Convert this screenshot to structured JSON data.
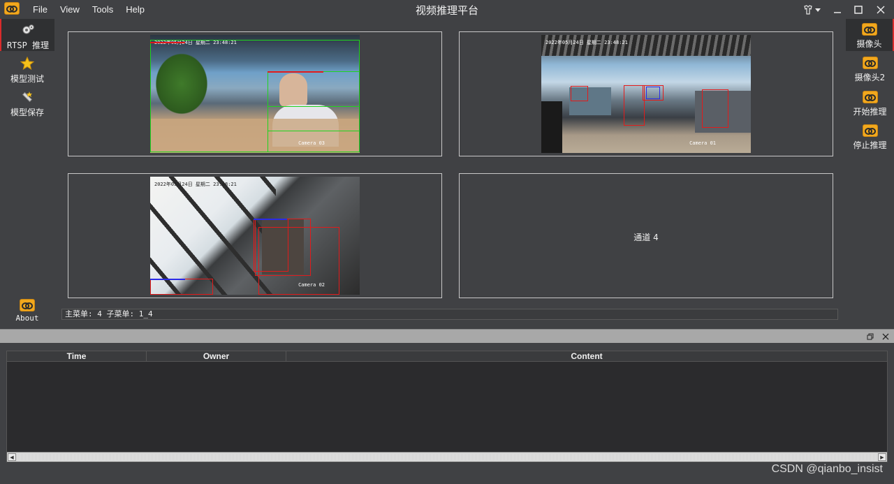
{
  "app": {
    "title": "视频推理平台",
    "menu": [
      "File",
      "View",
      "Tools",
      "Help"
    ]
  },
  "left_nav": {
    "items": [
      {
        "label": "RTSP 推理",
        "icon": "gear-icon",
        "active": true
      },
      {
        "label": "模型测试",
        "icon": "star-icon",
        "active": false
      },
      {
        "label": "模型保存",
        "icon": "wand-icon",
        "active": false
      }
    ],
    "about": {
      "label": "About",
      "icon": "logo-icon"
    }
  },
  "right_nav": {
    "items": [
      {
        "label": "摄像头",
        "active": true
      },
      {
        "label": "摄像头2",
        "active": false
      },
      {
        "label": "开始推理",
        "active": false
      },
      {
        "label": "停止推理",
        "active": false
      }
    ]
  },
  "channels": [
    {
      "stamp": "2022年05月24日 星期二 23:48:21",
      "camera": "Camera 03"
    },
    {
      "stamp": "2022年05月24日 星期二 23:48:21",
      "camera": "Camera 01"
    },
    {
      "stamp": "2022年05月24日 星期二 23:48:21",
      "camera": "Camera 02"
    },
    {
      "label": "通道 4"
    }
  ],
  "status": {
    "text": "主菜单: 4  子菜单: 1_4"
  },
  "log": {
    "columns": [
      "Time",
      "Owner",
      "Content"
    ],
    "rows": []
  },
  "watermark": "CSDN @qianbo_insist",
  "colors": {
    "background": "#404144",
    "accent": "#d92b2b",
    "logo": "#f2a81d",
    "box_green": "#1fd41f",
    "box_red": "#e21b1b",
    "box_blue": "#2a2ae8"
  }
}
